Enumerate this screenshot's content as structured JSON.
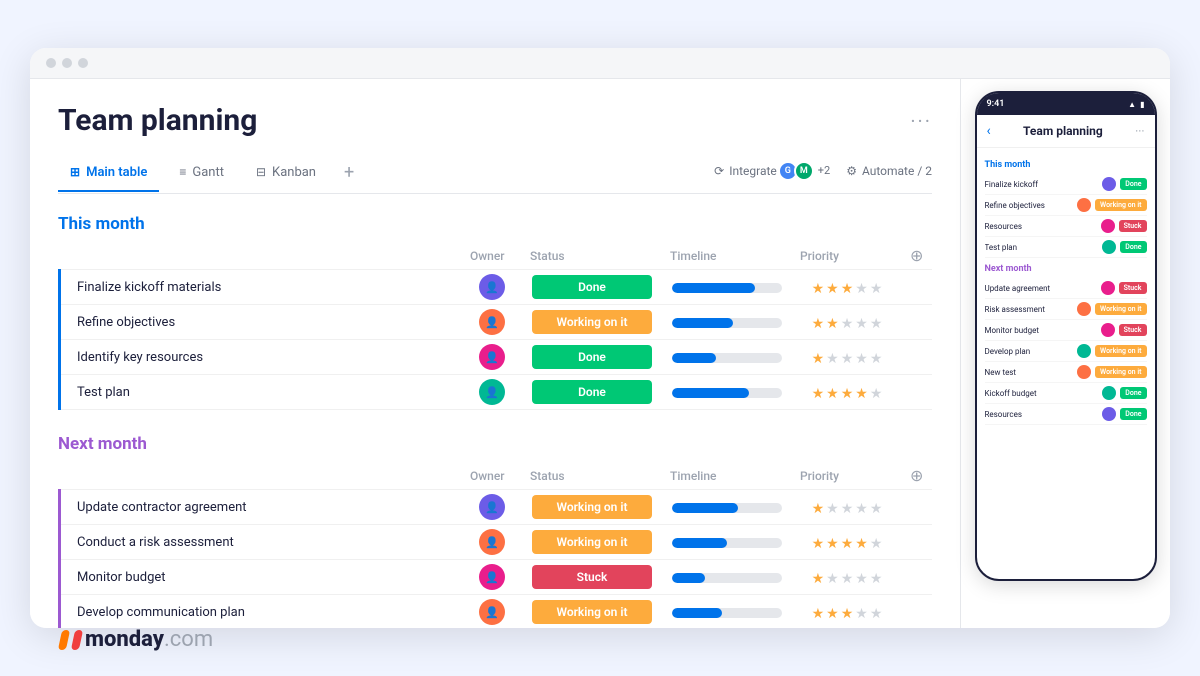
{
  "app": {
    "title": "Team planning",
    "more_label": "···"
  },
  "tabs": [
    {
      "id": "main-table",
      "label": "Main table",
      "icon": "⊞",
      "active": true
    },
    {
      "id": "gantt",
      "label": "Gantt",
      "icon": "≡",
      "active": false
    },
    {
      "id": "kanban",
      "label": "Kanban",
      "icon": "⊟",
      "active": false
    }
  ],
  "tab_add": "+",
  "toolbar": {
    "integrate_label": "Integrate",
    "automate_label": "Automate / 2",
    "avatar_count": "+2"
  },
  "sections": [
    {
      "id": "this-month",
      "title": "This month",
      "color": "this",
      "columns": [
        "Owner",
        "Status",
        "Timeline",
        "Priority"
      ],
      "tasks": [
        {
          "name": "Finalize kickoff materials",
          "owner_color": "#6c5ce7",
          "status": "Done",
          "status_class": "status-done",
          "timeline_pct": 75,
          "stars": 3,
          "group": "this"
        },
        {
          "name": "Refine objectives",
          "owner_color": "#fd7043",
          "status": "Working on it",
          "status_class": "status-working",
          "timeline_pct": 55,
          "stars": 2,
          "group": "this"
        },
        {
          "name": "Identify key resources",
          "owner_color": "#e91e8c",
          "status": "Done",
          "status_class": "status-done",
          "timeline_pct": 40,
          "stars": 1,
          "group": "this"
        },
        {
          "name": "Test plan",
          "owner_color": "#00b894",
          "status": "Done",
          "status_class": "status-done",
          "timeline_pct": 70,
          "stars": 4,
          "group": "this"
        }
      ]
    },
    {
      "id": "next-month",
      "title": "Next month",
      "color": "next",
      "columns": [
        "Owner",
        "Status",
        "Timeline",
        "Priority"
      ],
      "tasks": [
        {
          "name": "Update contractor agreement",
          "owner_color": "#6c5ce7",
          "status": "Working on it",
          "status_class": "status-working",
          "timeline_pct": 60,
          "stars": 1,
          "group": "next"
        },
        {
          "name": "Conduct a risk assessment",
          "owner_color": "#fd7043",
          "status": "Working on it",
          "status_class": "status-working",
          "timeline_pct": 50,
          "stars": 4,
          "group": "next"
        },
        {
          "name": "Monitor budget",
          "owner_color": "#e91e8c",
          "status": "Stuck",
          "status_class": "status-stuck",
          "timeline_pct": 30,
          "stars": 1,
          "group": "next"
        },
        {
          "name": "Develop communication plan",
          "owner_color": "#fd7043",
          "status": "Working on it",
          "status_class": "status-working",
          "timeline_pct": 45,
          "stars": 3,
          "group": "next"
        }
      ]
    }
  ],
  "mobile": {
    "time": "9:41",
    "title": "Team planning",
    "sections": [
      {
        "title": "This month",
        "color": "this",
        "rows": [
          {
            "name": "Finalize kickoff",
            "owner_color": "#6c5ce7",
            "status": "Done",
            "status_class": "pb-done"
          },
          {
            "name": "Refine objectives",
            "owner_color": "#fd7043",
            "status": "Working on it",
            "status_class": "pb-working"
          },
          {
            "name": "Resources",
            "owner_color": "#e91e8c",
            "status": "Stuck",
            "status_class": "pb-stuck"
          },
          {
            "name": "Test plan",
            "owner_color": "#00b894",
            "status": "Done",
            "status_class": "pb-done"
          }
        ]
      },
      {
        "title": "Next month",
        "color": "next",
        "rows": [
          {
            "name": "Update agreement",
            "owner_color": "#e91e8c",
            "status": "Stuck",
            "status_class": "pb-stuck"
          },
          {
            "name": "Risk assessment",
            "owner_color": "#fd7043",
            "status": "Working on it",
            "status_class": "pb-working"
          },
          {
            "name": "Monitor budget",
            "owner_color": "#e91e8c",
            "status": "Stuck",
            "status_class": "pb-stuck"
          },
          {
            "name": "Develop plan",
            "owner_color": "#00b894",
            "status": "Working on it",
            "status_class": "pb-working"
          },
          {
            "name": "New test",
            "owner_color": "#fd7043",
            "status": "Working on it",
            "status_class": "pb-working"
          },
          {
            "name": "Kickoff budget",
            "owner_color": "#00b894",
            "status": "Done",
            "status_class": "pb-done"
          },
          {
            "name": "Resources",
            "owner_color": "#6c5ce7",
            "status": "Done",
            "status_class": "pb-done"
          }
        ]
      }
    ]
  },
  "logo": {
    "monday": "monday",
    "com": ".com"
  }
}
